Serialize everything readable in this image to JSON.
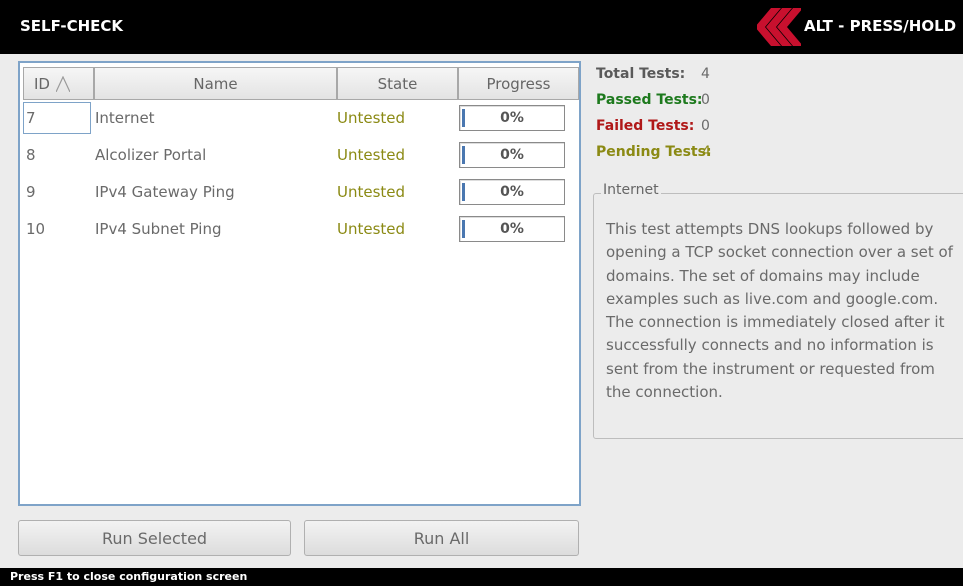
{
  "header": {
    "title": "SELF-CHECK",
    "alt_label": "ALT - PRESS/HOLD",
    "accent_color": "#c8102e"
  },
  "table": {
    "columns": [
      "ID",
      "Name",
      "State",
      "Progress"
    ],
    "sort_icon": "sort-ascending-icon",
    "rows": [
      {
        "id": "7",
        "name": "Internet",
        "state": "Untested",
        "progress": "0%"
      },
      {
        "id": "8",
        "name": "Alcolizer Portal",
        "state": "Untested",
        "progress": "0%"
      },
      {
        "id": "9",
        "name": "IPv4 Gateway Ping",
        "state": "Untested",
        "progress": "0%"
      },
      {
        "id": "10",
        "name": "IPv4 Subnet Ping",
        "state": "Untested",
        "progress": "0%"
      }
    ]
  },
  "buttons": {
    "run_selected": "Run Selected",
    "run_all": "Run All"
  },
  "stats": {
    "total_label": "Total Tests:",
    "total_value": "4",
    "passed_label": "Passed Tests:",
    "passed_value": "0",
    "failed_label": "Failed Tests:",
    "failed_value": "0",
    "pending_label": "Pending Tests:",
    "pending_value": "4",
    "colors": {
      "total": "#5a5a5a",
      "passed": "#1e7a1e",
      "failed": "#b01818",
      "pending": "#8b8a14"
    }
  },
  "detail": {
    "title": "Internet",
    "description": "This test attempts DNS lookups followed by opening a TCP socket connection over a set of domains. The set of domains may include examples such as live.com and google.com. The connection is immediately closed after it successfully connects and no information is sent from the instrument or requested from the connection."
  },
  "footer": {
    "text": "Press F1 to close configuration screen"
  }
}
